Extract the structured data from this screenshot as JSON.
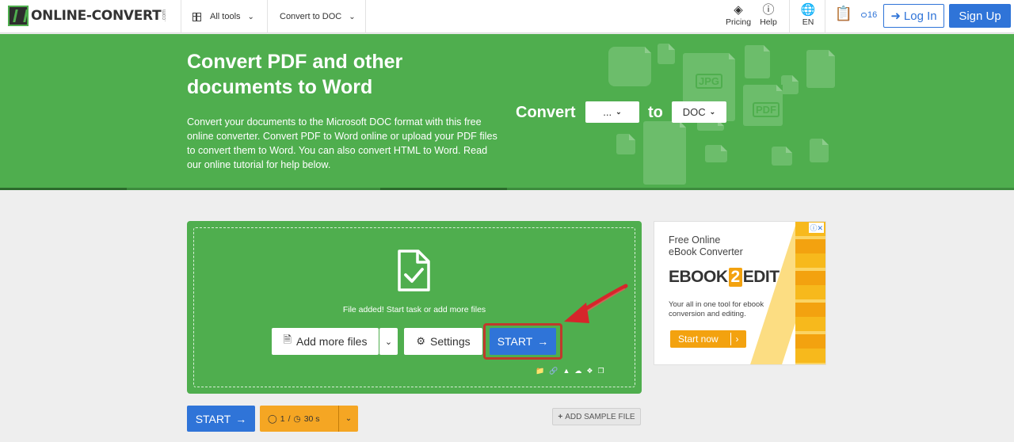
{
  "nav": {
    "logo_text": "ONLINE-CONVERT",
    "logo_suffix": ".com",
    "all_tools": "All tools",
    "convert_to": "Convert to DOC",
    "pricing": "Pricing",
    "help": "Help",
    "language": "EN",
    "credits": "16",
    "login": "Log In",
    "signup": "Sign Up"
  },
  "hero": {
    "title": "Convert PDF and other documents to Word",
    "description": "Convert your documents to the Microsoft DOC format with this free online converter. Convert PDF to Word online or upload your PDF files to convert them to Word. You can also convert HTML to Word. Read our online tutorial for help below.",
    "convert_label": "Convert",
    "from_value": "...",
    "to_label": "to",
    "to_value": "DOC",
    "bg_labels": [
      "JPG",
      "PDF"
    ]
  },
  "upload": {
    "status": "File added! Start task or add more files",
    "add_more": "Add more files",
    "settings": "Settings",
    "start": "START",
    "sources": [
      "folder-icon",
      "link-icon",
      "google-drive-icon",
      "onedrive-icon",
      "dropbox-icon",
      "clipboard-icon"
    ]
  },
  "ad": {
    "line1": "Free Online",
    "line2": "eBook Converter",
    "brand_a": "EBOOK",
    "brand_b": "2",
    "brand_c": "EDIT",
    "tagline": "Your all in one tool for ebook conversion and editing.",
    "cta": "Start now"
  },
  "bottom": {
    "start": "START",
    "files": "1",
    "time": "30 s",
    "sample": "ADD SAMPLE FILE"
  },
  "colors": {
    "green": "#4fae4e",
    "blue": "#2f74d8",
    "orange": "#f5a623",
    "highlight": "#c0392b"
  }
}
